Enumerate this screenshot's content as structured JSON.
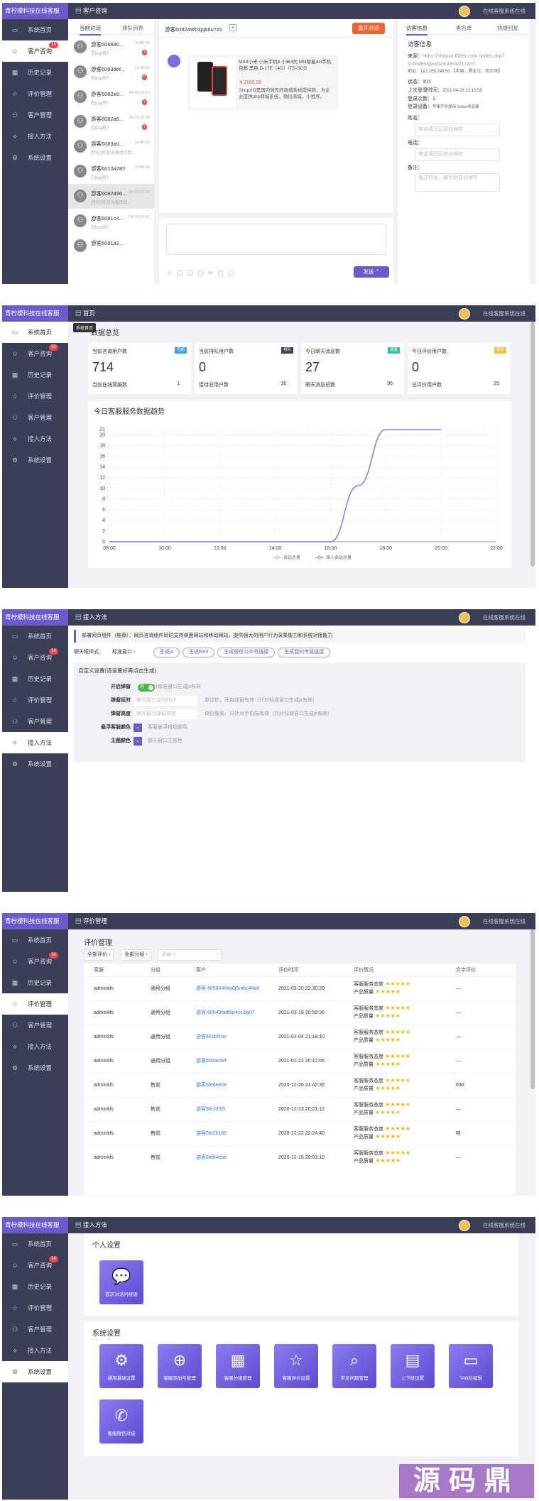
{
  "brand": "青柠檬科技在线客服",
  "online_label": "在线客服系统在线",
  "menu": [
    {
      "label": "系统首页",
      "icon": "monitor-icon"
    },
    {
      "label": "客户咨询",
      "icon": "smile-icon"
    },
    {
      "label": "历史记录",
      "icon": "calendar-icon"
    },
    {
      "label": "评价管理",
      "icon": "star-icon"
    },
    {
      "label": "客户管理",
      "icon": "user-icon"
    },
    {
      "label": "接入方法",
      "icon": "plug-icon"
    },
    {
      "label": "系统设置",
      "icon": "gear-icon"
    }
  ],
  "badges": {
    "s1": "14",
    "s2": "20",
    "s3": "14",
    "s4": "14",
    "s5": "14"
  },
  "s1": {
    "crumb": "客户咨询",
    "tabs": [
      "当前对话",
      "排队列表"
    ],
    "sessions": [
      {
        "name": "游客608840...",
        "time": "10:40:00",
        "msg": "在bug有?",
        "count": "3"
      },
      {
        "name": "游客6083def...",
        "time": "10:40:00",
        "msg": "在bug有?",
        "count": "0"
      },
      {
        "name": "游客6082e8...",
        "time": "04-16 16:13",
        "msg": "在bug有?",
        "count": "2"
      },
      {
        "name": "游客6082a6...",
        "time": "04-16 16:48",
        "msg": "在bug有?",
        "count": "2"
      },
      {
        "name": "游客6083a0...",
        "time": "10:40:00",
        "msg": "[你好]欢迎光临请问您...",
        "count": ""
      },
      {
        "name": "游客6013a282",
        "time": "10:40:00",
        "msg": "在bug有?",
        "count": ""
      },
      {
        "name": "游客6082496...",
        "time": "04-16 12:15",
        "msg": "[你好]欢迎光临请问...",
        "count": ""
      },
      {
        "name": "游客6081c4...",
        "time": "04-16 02:51",
        "msg": "在bug有?",
        "count": ""
      },
      {
        "name": "游客6081a2...",
        "time": "",
        "msg": "",
        "count": ""
      }
    ],
    "chat_title": "游客608249fb3jqb6u7z5",
    "add_label": "+",
    "reopen": "重开对话",
    "product": {
      "title": "MIUI小米 小米手机4 小米4代 MI4智能4G手机包邮 黑色 D-LTE（4G）/TD-SCD",
      "price": "￥2100.00",
      "desc": "ShopXO是国内领先的商城系统提供商，为企业提供php商城系统、微信商城、小程序。"
    },
    "send": "发送",
    "right_tabs": [
      "访客信息",
      "黑名单",
      "快捷回复"
    ],
    "info_title": "访客信息",
    "source_label": "来源：",
    "source_url": "https://shopxo.l02ex.com /index.php?s=/index/goods/index/id/1.html",
    "addr": "地址：122.159.248.50 【中国，黑龙江，哈尔滨】",
    "status_label": "状态：",
    "status_val": "离线",
    "last_label": "上次登录时间：",
    "last_val": "2021-04-23 12:15:56",
    "times_label": "登录次数：",
    "times_val": "1",
    "device_label": "登录设备：",
    "device_val": "苹果手机使用 Safari浏览器",
    "name_label": "姓名：",
    "name_ph": "姓名填写后自动保存",
    "phone_label": "电话：",
    "phone_ph": "电话填写后自动保存",
    "note_label": "备注：",
    "note_ph": "备注信息，填写后自动保存"
  },
  "s2": {
    "crumb": "首页",
    "tooltip": "系统首页",
    "overview": "数据总览",
    "cards": [
      {
        "title": "当前咨询用户数",
        "tag": "当前",
        "tag_color": "#3ea0f7",
        "value": "714",
        "sub": "当前在线客服数",
        "sub_val": "1"
      },
      {
        "title": "当前排队用户数",
        "tag": "排队",
        "tag_color": "#3a3f55",
        "value": "0",
        "sub": "接待总用户数",
        "sub_val": "16"
      },
      {
        "title": "今日聊天消息数",
        "tag": "消息",
        "tag_color": "#2fc1a0",
        "value": "27",
        "sub": "聊天消息总数",
        "sub_val": "96"
      },
      {
        "title": "今日评价用户数",
        "tag": "评价",
        "tag_color": "#f4c34a",
        "value": "0",
        "sub": "总评价用户数",
        "sub_val": "25"
      }
    ],
    "chart_title": "今日客服服务数据趋势"
  },
  "chart_data": {
    "type": "line",
    "title": "今日客服服务数据趋势",
    "x": [
      "08:00",
      "10:00",
      "12:00",
      "14:00",
      "16:00",
      "18:00",
      "20:00",
      "22:00"
    ],
    "yticks": [
      0,
      2,
      4,
      6,
      8,
      10,
      12,
      14,
      16,
      18,
      20,
      21
    ],
    "ylim": [
      0,
      21
    ],
    "series": [
      {
        "name": "会话总量",
        "color": "#f3a0c0",
        "points": [
          [
            8,
            0
          ],
          [
            10,
            0
          ],
          [
            12,
            0
          ],
          [
            14,
            0
          ],
          [
            16,
            0
          ],
          [
            17,
            10.5
          ],
          [
            18,
            21
          ],
          [
            20,
            21
          ]
        ]
      },
      {
        "name": "接入会话总量",
        "color": "#8a7cf0",
        "points": [
          [
            8,
            0
          ],
          [
            10,
            0
          ],
          [
            12,
            0
          ],
          [
            14,
            0
          ],
          [
            16,
            0
          ],
          [
            17,
            10.5
          ],
          [
            18,
            21
          ],
          [
            20,
            21
          ]
        ]
      }
    ],
    "legend": "bottom-center"
  },
  "s3": {
    "crumb": "接入方法",
    "notice": "部署网页组件（推荐）：网页咨询组件同时支持桌面网站和移动网站，提供强大的用户行为采集能力和系统对接能力",
    "style_label": "聊天框样式：",
    "style_select": "标准窗口",
    "btns": [
      "生成js",
      "生成html",
      "生成微信公众号链接",
      "生成我的专属链接"
    ],
    "custom_title": "自定义设置(请设置好再点击生成)",
    "rows": [
      {
        "label": "开启弹窗",
        "control": "开",
        "hint": "只对标准窗口生成js有效"
      },
      {
        "label": "弹窗延时",
        "control": "聊天窗口延时时间",
        "hint": "单位秒，开启弹窗有效（只对标准窗口生成js有效）"
      },
      {
        "label": "弹窗高度",
        "control": "聊天窗口弹窗高度",
        "hint": "单位像素，只针对手机端有效（只对标准窗口生成js有效）"
      },
      {
        "label": "悬浮客服颜色",
        "control": "",
        "hint": "客服悬浮按钮颜色"
      },
      {
        "label": "主题颜色",
        "control": "",
        "hint": "聊天窗口主题色"
      }
    ]
  },
  "s4": {
    "crumb": "评价管理",
    "title": "评价管理",
    "filter1": "全部评价",
    "filter2": "全部分组",
    "search_ph": "请输入",
    "cols": [
      "客服",
      "分组",
      "客户",
      "评价时间",
      "评价情况",
      "文字评价"
    ],
    "score_a": "客服服务态度",
    "score_b": "产品质量",
    "rows": [
      {
        "kf": "adminkfs",
        "group": "通用分组",
        "client": "游客 60580464a0j5m6c44a8",
        "time": "2021-03-20 22:30:20",
        "text": "—"
      },
      {
        "kf": "adminkfs",
        "group": "通用分组",
        "client": "游客 60549fadf6p4yx3jq07",
        "time": "2021-03-19 20:59:36",
        "text": "—"
      },
      {
        "kf": "adminkfs",
        "group": "通用分组",
        "client": "游客601bf1bc",
        "time": "2021-02-04 21:18:10",
        "text": "—"
      },
      {
        "kf": "adminkfs",
        "group": "通用分组",
        "client": "游客600ac0ef",
        "time": "2021-01-22 20:12:06",
        "text": "—"
      },
      {
        "kf": "adminkfs",
        "group": "售前",
        "client": "游客5fe6ee0e",
        "time": "2020-12-26 21:42:35",
        "text": "636"
      },
      {
        "kf": "adminkfs",
        "group": "售前",
        "client": "游客5fe335f5",
        "time": "2020-12-23 20:21:12",
        "text": "—"
      },
      {
        "kf": "adminkfs",
        "group": "售前",
        "client": "游客5fe20165",
        "time": "2020-12-22 22:24:40",
        "text": "哇"
      },
      {
        "kf": "adminkfs",
        "group": "售前",
        "client": "游客5fd84ebe",
        "time": "2020-12-15 20:03:10",
        "text": "—"
      }
    ]
  },
  "s5": {
    "crumb": "接入方法",
    "personal": "个人设置",
    "personal_tiles": [
      {
        "label": "首次对话问候语",
        "glyph": "💬"
      }
    ],
    "system": "系统设置",
    "system_tiles": [
      {
        "label": "通用基础设置",
        "glyph": "⚙"
      },
      {
        "label": "客服添加与管理",
        "glyph": "⊕"
      },
      {
        "label": "客服分组管理",
        "glyph": "▦"
      },
      {
        "label": "客服评价设置",
        "glyph": "☆"
      },
      {
        "label": "常见问题管理",
        "glyph": "⌕"
      },
      {
        "label": "上下班设置",
        "glyph": "▤"
      },
      {
        "label": "TAB栏编辑",
        "glyph": "▭"
      },
      {
        "label": "客服微信对接",
        "glyph": "✆"
      }
    ],
    "watermark": "源码鼎"
  }
}
